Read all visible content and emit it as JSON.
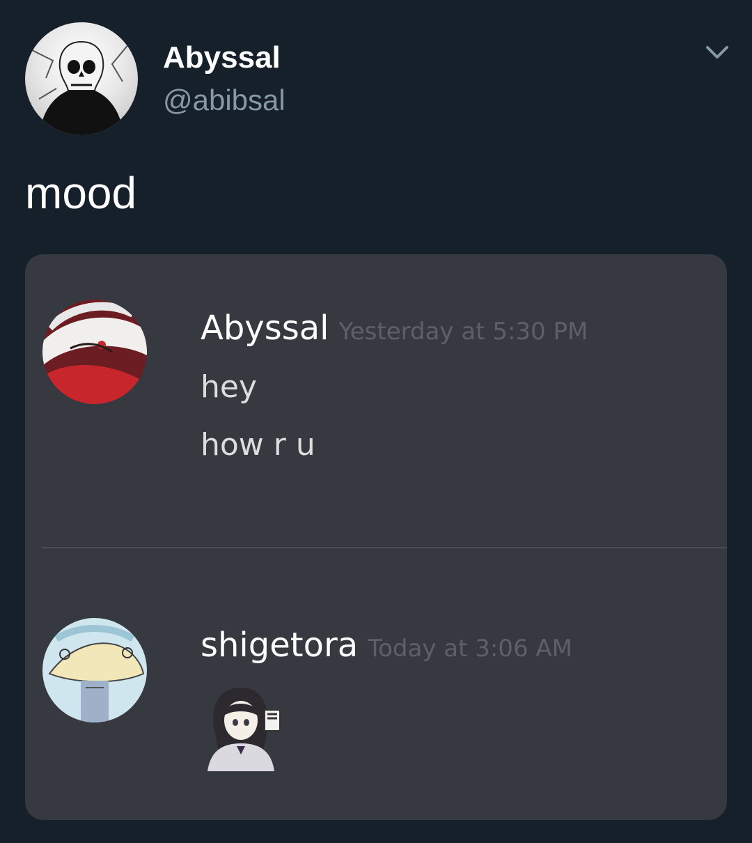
{
  "tweet": {
    "author_name": "Abyssal",
    "author_handle": "@abibsal",
    "text": "mood",
    "icons": {
      "menu": "chevron-down-icon",
      "avatar": "skull-avatar"
    }
  },
  "screenshot": {
    "messages": [
      {
        "author": "Abyssal",
        "timestamp": "Yesterday at 5:30 PM",
        "lines": [
          "hey",
          "how r u"
        ]
      },
      {
        "author": "shigetora",
        "timestamp": "Today at 3:06 AM",
        "lines": [],
        "attachment": "anime-girl-sticker"
      }
    ]
  },
  "colors": {
    "background": "#15202b",
    "card": "#36393f",
    "handle": "#8899a6",
    "timestamp": "#5d6066"
  }
}
